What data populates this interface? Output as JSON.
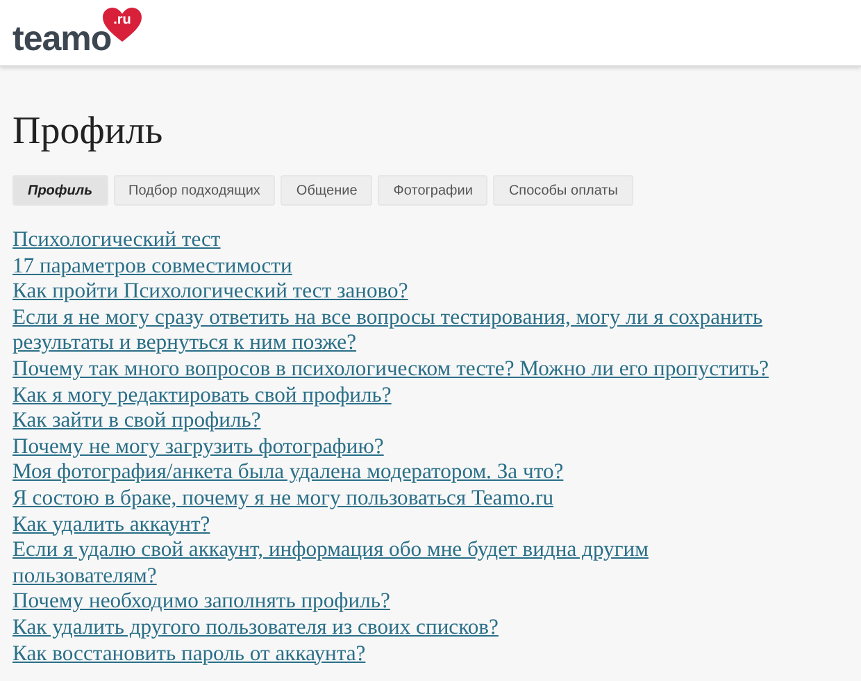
{
  "header": {
    "logo": {
      "text": "teamo",
      "badge": ".ru"
    }
  },
  "page": {
    "title": "Профиль"
  },
  "tabs": [
    {
      "label": "Профиль",
      "selected": true
    },
    {
      "label": "Подбор подходящих",
      "selected": false
    },
    {
      "label": "Общение",
      "selected": false
    },
    {
      "label": "Фотографии",
      "selected": false
    },
    {
      "label": "Способы оплаты",
      "selected": false
    }
  ],
  "links": [
    "Психологический тест",
    "17 параметров совместимости",
    "Как пройти Психологический тест заново?",
    "Если я не могу сразу ответить на все вопросы тестирования, могу ли я сохранить результаты и вернуться к ним позже?",
    "Почему так много вопросов в психологическом тесте? Можно ли его пропустить?",
    "Как я могу редактировать свой профиль?",
    "Как зайти в свой профиль?",
    "Почему не могу загрузить фотографию?",
    "Моя фотография/анкета была удалена модератором. За что?",
    "Я состою в браке, почему я не могу пользоваться Teamo.ru",
    "Как удалить аккаунт?",
    "Если я удалю свой аккаунт, информация обо мне будет видна другим пользователям?",
    "Почему необходимо заполнять профиль?",
    "Как удалить другого пользователя из своих списков?",
    "Как восстановить пароль от аккаунта?"
  ]
}
